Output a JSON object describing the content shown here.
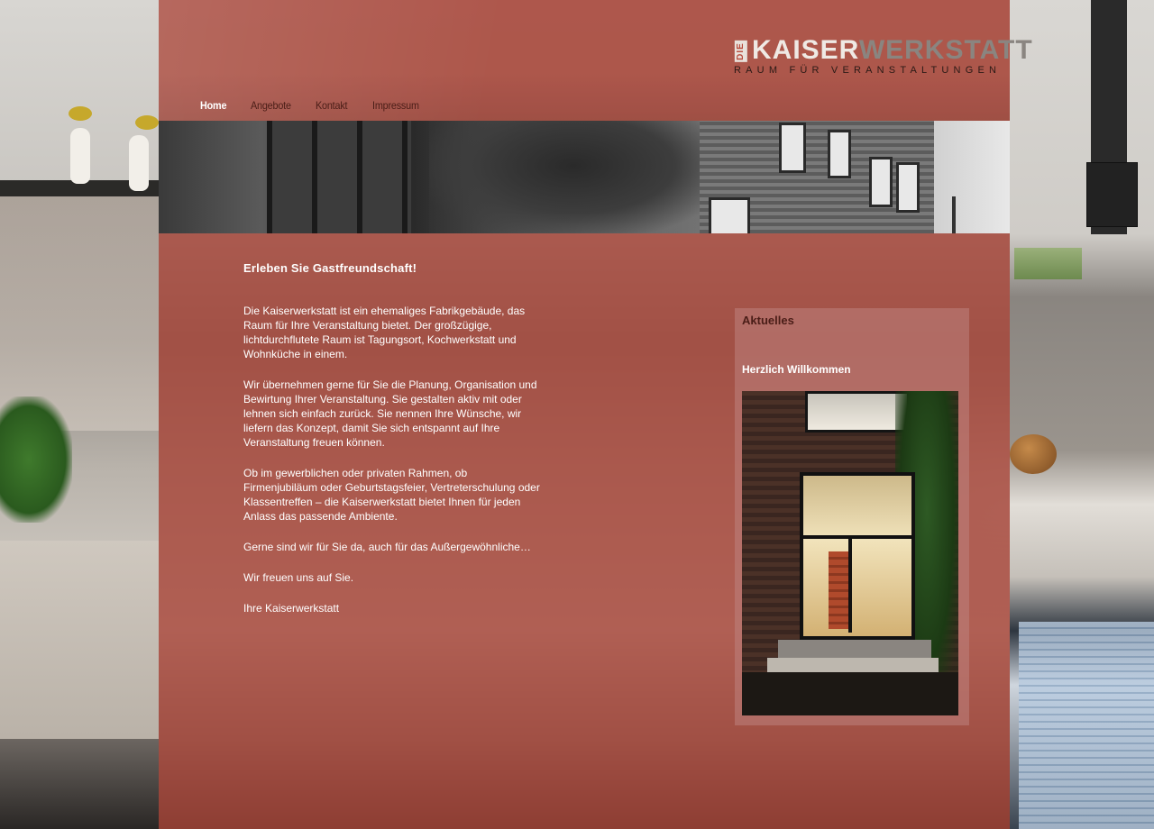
{
  "brand": {
    "prefix": "DIE",
    "name_part1": "KAISER",
    "name_part2": "WERKSTATT",
    "tagline": "RAUM FÜR VERANSTALTUNGEN"
  },
  "nav": {
    "items": [
      {
        "label": "Home",
        "active": true
      },
      {
        "label": "Angebote",
        "active": false
      },
      {
        "label": "Kontakt",
        "active": false
      },
      {
        "label": "Impressum",
        "active": false
      }
    ]
  },
  "main": {
    "heading": "Erleben Sie Gastfreundschaft!",
    "paragraphs": [
      "Die Kaiserwerkstatt ist ein ehemaliges Fabrikgebäude, das Raum für Ihre Veranstaltung bietet. Der großzügige, lichtdurchflutete Raum ist Tagungsort, Kochwerkstatt und Wohnküche in einem.",
      "Wir übernehmen gerne für Sie die Planung, Organisation und Bewirtung Ihrer Veranstaltung. Sie gestalten aktiv mit oder lehnen sich einfach zurück. Sie nennen Ihre Wünsche, wir liefern das Konzept, damit Sie sich entspannt auf Ihre Veranstaltung freuen können.",
      "Ob im gewerblichen oder privaten Rahmen, ob Firmenjubiläum oder Geburtstagsfeier, Vertreterschulung oder Klassentreffen – die Kaiserwerkstatt bietet Ihnen für jeden Anlass das passende Ambiente.",
      "Gerne sind wir für Sie da, auch für das Außergewöhnliche…",
      "Wir freuen uns auf Sie.",
      "Ihre Kaiserwerkstatt"
    ]
  },
  "sidebar": {
    "title": "Aktuelles",
    "news_title": "Herzlich Willkommen"
  },
  "colors": {
    "overlay": "#a64236",
    "nav_text": "#4a1d17",
    "nav_active": "#ffffff"
  }
}
